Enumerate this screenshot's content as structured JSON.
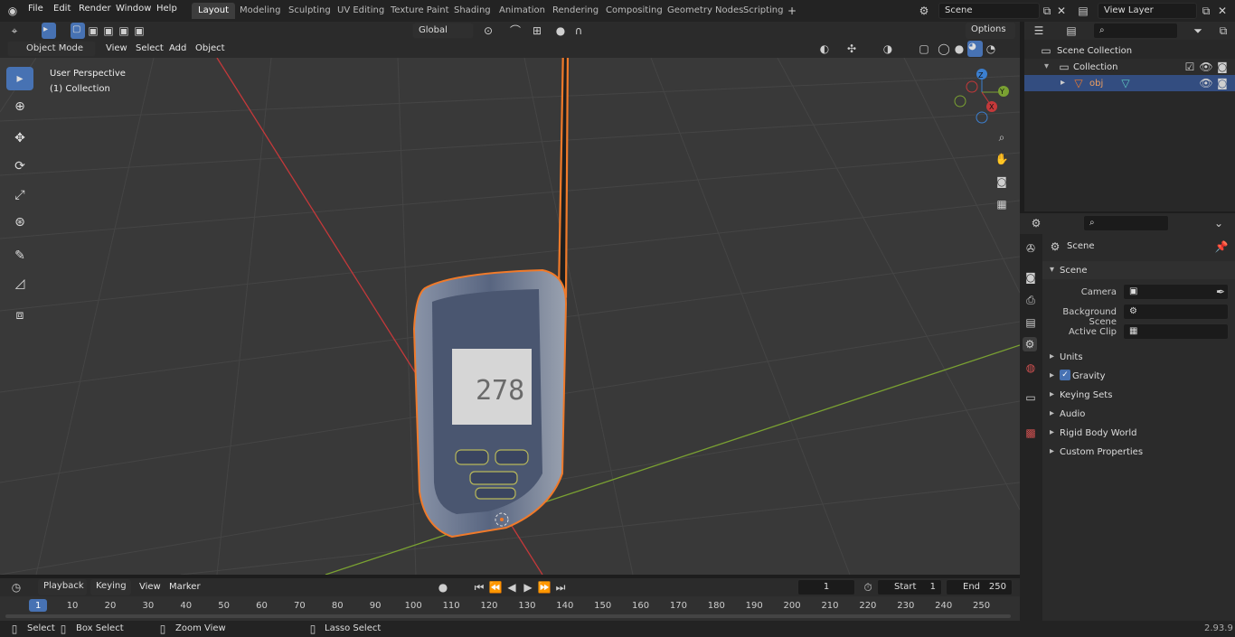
{
  "menubar": {
    "items": [
      "File",
      "Edit",
      "Render",
      "Window",
      "Help"
    ],
    "workspaces": [
      "Layout",
      "Modeling",
      "Sculpting",
      "UV Editing",
      "Texture Paint",
      "Shading",
      "Animation",
      "Rendering",
      "Compositing",
      "Geometry Nodes",
      "Scripting"
    ],
    "active_workspace": "Layout",
    "scene_name": "Scene",
    "view_layer": "View Layer"
  },
  "viewport_header": {
    "mode": "Object Mode",
    "menus": [
      "View",
      "Select",
      "Add",
      "Object"
    ],
    "orientation": "Global",
    "options_label": "Options"
  },
  "viewport": {
    "perspective_label": "User Perspective",
    "collection_label": "(1) Collection",
    "display_reading": "278",
    "gizmo_axes": {
      "x": "X",
      "y": "Y",
      "z": "Z"
    }
  },
  "outliner": {
    "scene_collection": "Scene Collection",
    "collection": "Collection",
    "object": "obj"
  },
  "properties": {
    "context": "Scene",
    "panel_title": "Scene",
    "camera_label": "Camera",
    "background_scene_label": "Background Scene",
    "active_clip_label": "Active Clip",
    "sections": [
      "Units",
      "Gravity",
      "Keying Sets",
      "Audio",
      "Rigid Body World",
      "Custom Properties"
    ]
  },
  "timeline": {
    "menus": [
      "Playback",
      "Keying",
      "View",
      "Marker"
    ],
    "current_frame": "1",
    "start_label": "Start",
    "start_value": "1",
    "end_label": "End",
    "end_value": "250",
    "ticks": [
      "1",
      "10",
      "20",
      "30",
      "40",
      "50",
      "60",
      "70",
      "80",
      "90",
      "100",
      "110",
      "120",
      "130",
      "140",
      "150",
      "160",
      "170",
      "180",
      "190",
      "200",
      "210",
      "220",
      "230",
      "240",
      "250"
    ]
  },
  "statusbar": {
    "select": "Select",
    "box_select": "Box Select",
    "zoom_view": "Zoom View",
    "lasso_select": "Lasso Select",
    "version": "2.93.9"
  },
  "colors": {
    "accent": "#4772b3",
    "selection_outline": "#f07a2a",
    "x_axis": "#c4393a",
    "y_axis": "#7aa132"
  }
}
